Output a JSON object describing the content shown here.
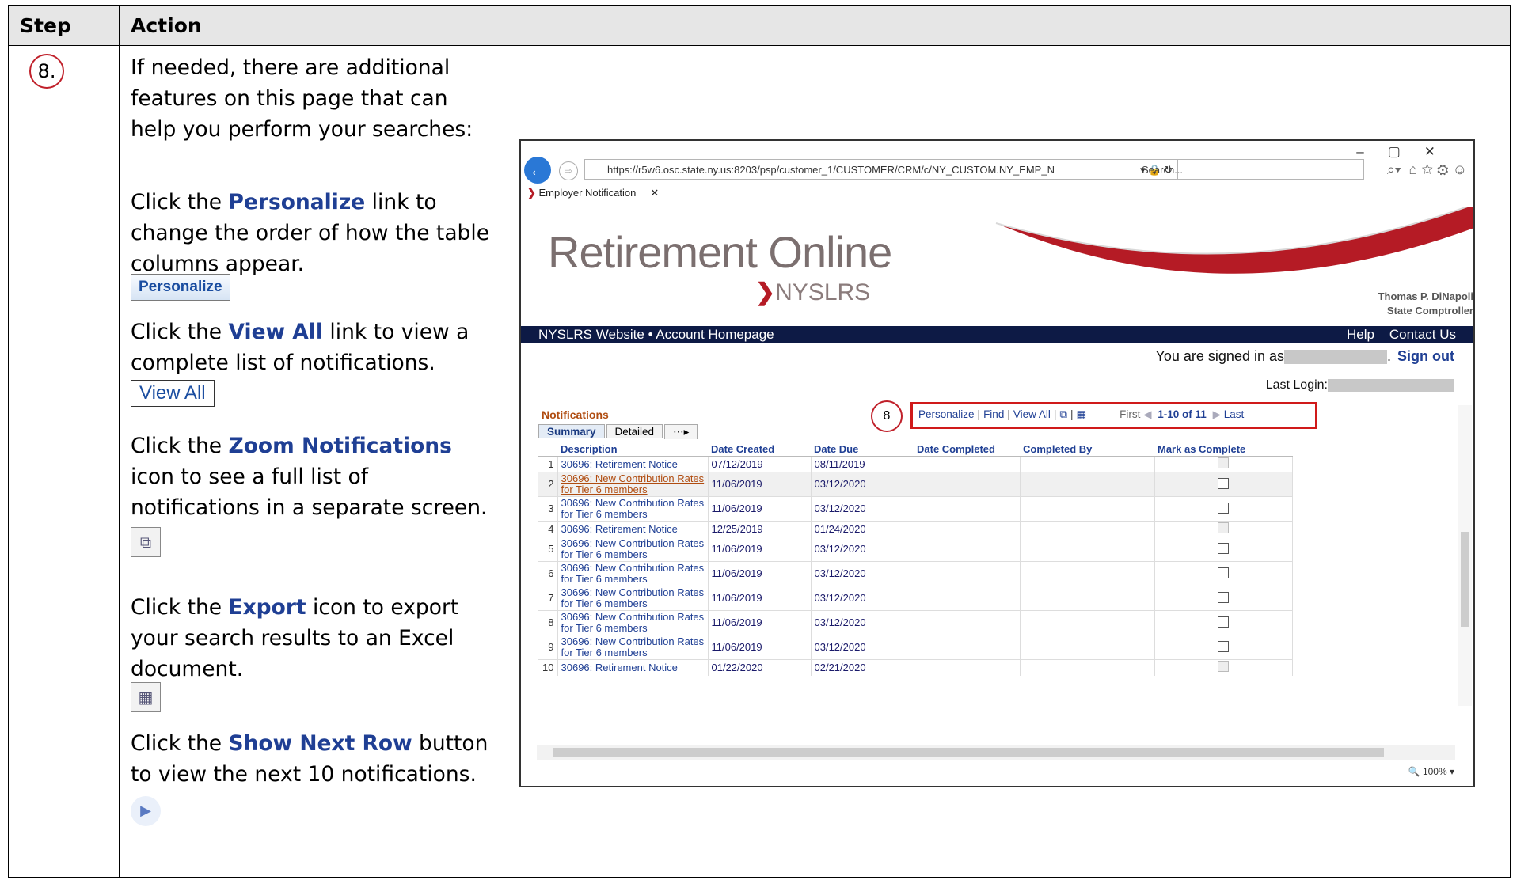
{
  "table": {
    "header_step": "Step",
    "header_action": "Action",
    "step_number": "8."
  },
  "instructions": {
    "intro": "If needed, there are additional features on this page that can help you perform your searches:",
    "personalize_pre": "Click the ",
    "personalize_term": "Personalize",
    "personalize_post": " link to change the order of how the table columns appear.",
    "personalize_button": "Personalize",
    "viewall_pre": "Click the ",
    "viewall_term": "View All",
    "viewall_post": " link to view a complete list of notifications.",
    "viewall_button": "View All",
    "zoom_pre": "Click the ",
    "zoom_term": "Zoom Notifications",
    "zoom_post": " icon to see a full list of notifications in a separate screen.",
    "export_pre": "Click the ",
    "export_term": "Export",
    "export_post": " icon to export your search results to an Excel document.",
    "next_pre": "Click the ",
    "next_term": "Show Next Row",
    "next_post": " button to view the next 10 notifications."
  },
  "browser": {
    "url": "https://r5w6.osc.state.ny.us:8203/psp/customer_1/CUSTOMER/CRM/c/NY_CUSTOM.NY_EMP_N",
    "search_placeholder": "Search...",
    "tab_title": "Employer Notification",
    "zoom_level": "100%"
  },
  "site": {
    "logo_main": "Retirement Online",
    "logo_sub": "NYSLRS",
    "comptroller_name": "Thomas P. DiNapoli",
    "comptroller_title": "State Comptroller",
    "nav_left": "NYSLRS Website  •  Account Homepage",
    "nav_help": "Help",
    "nav_contact": "Contact Us",
    "signed_in": "You are signed in as",
    "sign_out": "Sign out",
    "last_login": "Last Login:"
  },
  "grid": {
    "title": "Notifications",
    "callout": "8",
    "personalize": "Personalize",
    "find": "Find",
    "view_all": "View All",
    "first": "First",
    "count": "1-10 of 11",
    "last": "Last",
    "tab_summary": "Summary",
    "tab_detailed": "Detailed",
    "columns": [
      "Description",
      "Date Created",
      "Date Due",
      "Date Completed",
      "Completed By",
      "Mark as Complete"
    ],
    "rows": [
      {
        "n": "1",
        "desc": "30696: Retirement Notice",
        "created": "07/12/2019",
        "due": "08/11/2019"
      },
      {
        "n": "2",
        "desc": "30696: New Contribution Rates for Tier 6 members",
        "created": "11/06/2019",
        "due": "03/12/2020"
      },
      {
        "n": "3",
        "desc": "30696: New Contribution Rates for Tier 6 members",
        "created": "11/06/2019",
        "due": "03/12/2020"
      },
      {
        "n": "4",
        "desc": "30696: Retirement Notice",
        "created": "12/25/2019",
        "due": "01/24/2020"
      },
      {
        "n": "5",
        "desc": "30696: New Contribution Rates for Tier 6 members",
        "created": "11/06/2019",
        "due": "03/12/2020"
      },
      {
        "n": "6",
        "desc": "30696: New Contribution Rates for Tier 6 members",
        "created": "11/06/2019",
        "due": "03/12/2020"
      },
      {
        "n": "7",
        "desc": "30696: New Contribution Rates for Tier 6 members",
        "created": "11/06/2019",
        "due": "03/12/2020"
      },
      {
        "n": "8",
        "desc": "30696: New Contribution Rates for Tier 6 members",
        "created": "11/06/2019",
        "due": "03/12/2020"
      },
      {
        "n": "9",
        "desc": "30696: New Contribution Rates for Tier 6 members",
        "created": "11/06/2019",
        "due": "03/12/2020"
      },
      {
        "n": "10",
        "desc": "30696: Retirement Notice",
        "created": "01/22/2020",
        "due": "02/21/2020"
      }
    ]
  }
}
